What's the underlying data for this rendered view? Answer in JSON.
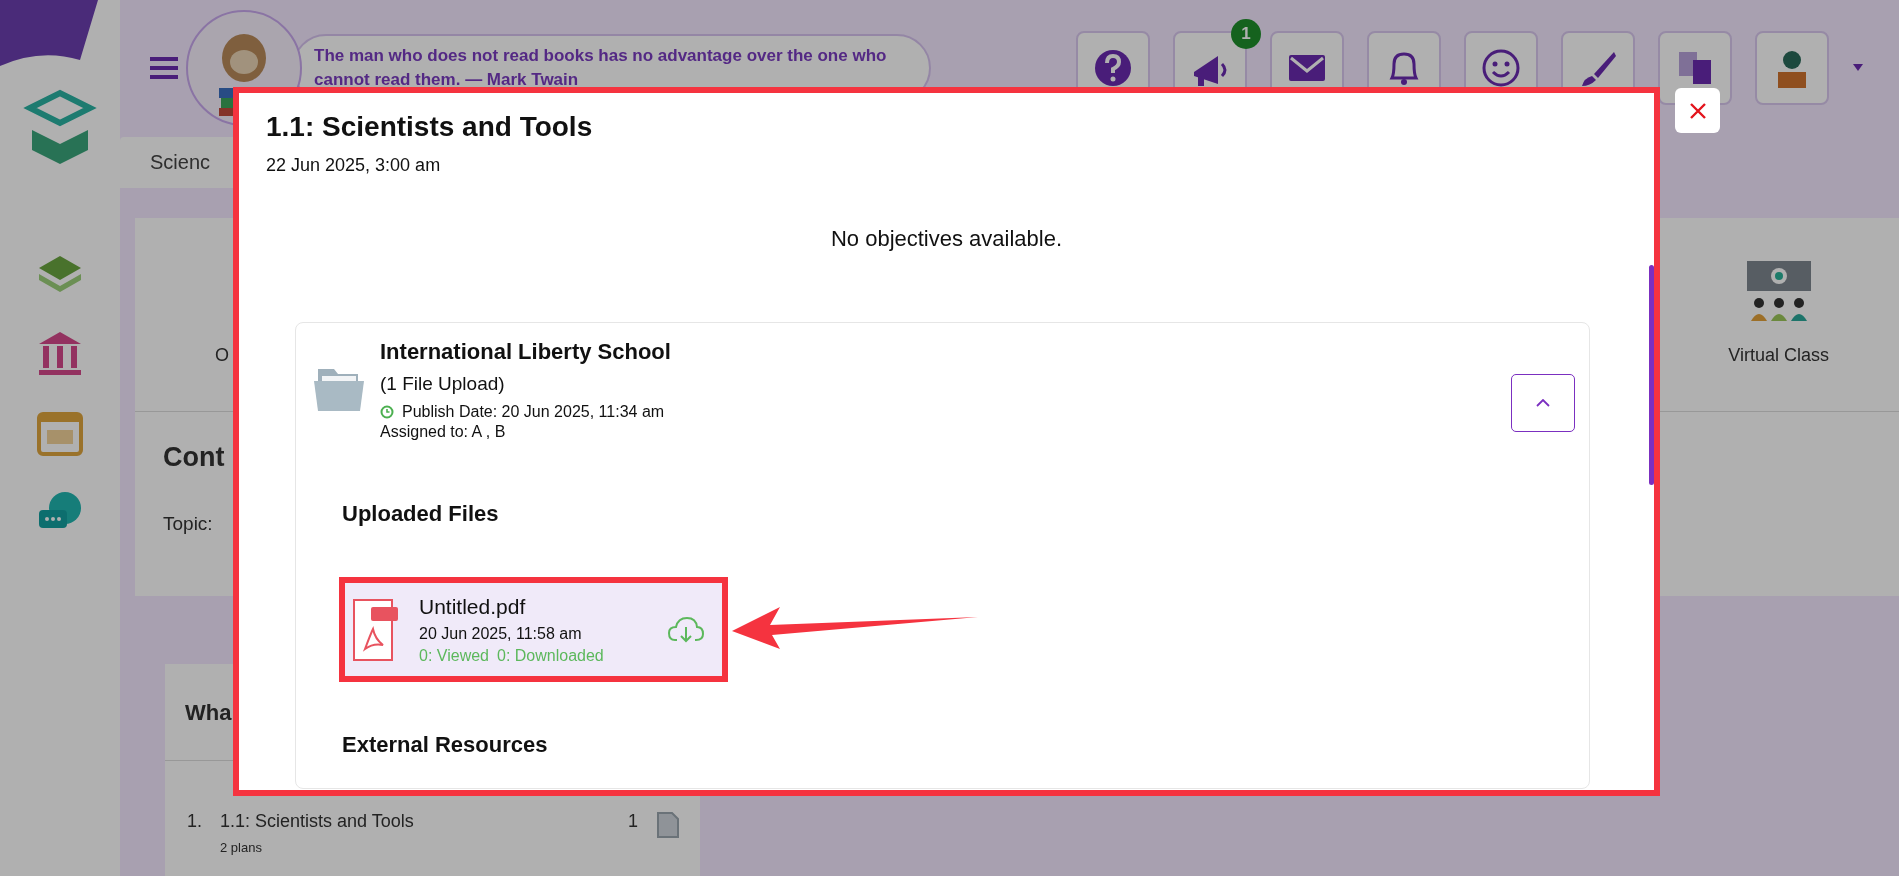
{
  "header": {
    "quote": "The man who does not read books has no advantage over the one who cannot read them. — Mark Twain",
    "notification_badge": "1"
  },
  "background": {
    "subject_tab": "Scienc",
    "tiles": [
      {
        "label": "O"
      },
      {
        "label": "Virtual Class"
      }
    ],
    "content_title": "Cont",
    "topic_label": "Topic:",
    "list_title": "Wha",
    "list_items": [
      {
        "number": "1.",
        "title": "1.1: Scientists and Tools",
        "subtitle": "2 plans",
        "count": "1"
      }
    ]
  },
  "modal": {
    "title": "1.1: Scientists and Tools",
    "date": "22 Jun 2025, 3:00 am",
    "objectives_message": "No objectives available.",
    "group": {
      "name": "International Liberty School",
      "count_label": "(1 File Upload)",
      "publish_date": "Publish Date: 20 Jun 2025, 11:34 am",
      "assigned": "Assigned to: A , B",
      "expanded": true,
      "uploaded_heading": "Uploaded Files",
      "files": [
        {
          "name": "Untitled.pdf",
          "date": "20 Jun 2025, 11:58 am",
          "viewed": "0: Viewed",
          "downloaded": "0: Downloaded"
        }
      ],
      "external_heading": "External Resources"
    }
  }
}
